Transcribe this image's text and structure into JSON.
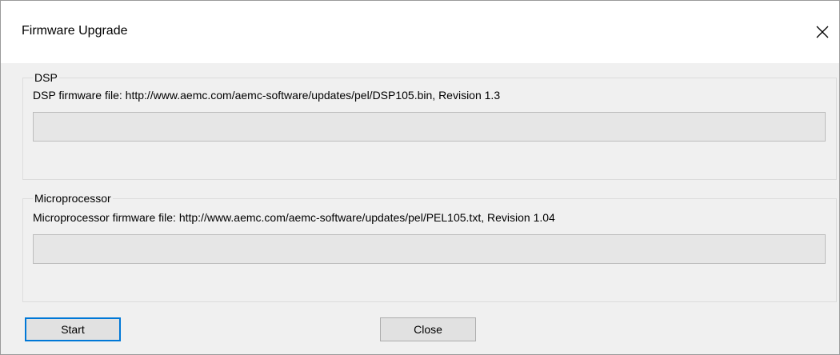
{
  "window": {
    "title": "Firmware Upgrade",
    "close_icon": "close-icon"
  },
  "dsp": {
    "group_label": "DSP",
    "file_text": "DSP firmware file: http://www.aemc.com/aemc-software/updates/pel/DSP105.bin, Revision 1.3",
    "progress": 0
  },
  "microprocessor": {
    "group_label": "Microprocessor",
    "file_text": "Microprocessor firmware file: http://www.aemc.com/aemc-software/updates/pel/PEL105.txt, Revision 1.04",
    "progress": 0
  },
  "buttons": {
    "start_label": "Start",
    "close_label": "Close"
  },
  "colors": {
    "dialog_background": "#f0f0f0",
    "progress_track": "#e6e6e6",
    "focus_border": "#0078d7"
  }
}
